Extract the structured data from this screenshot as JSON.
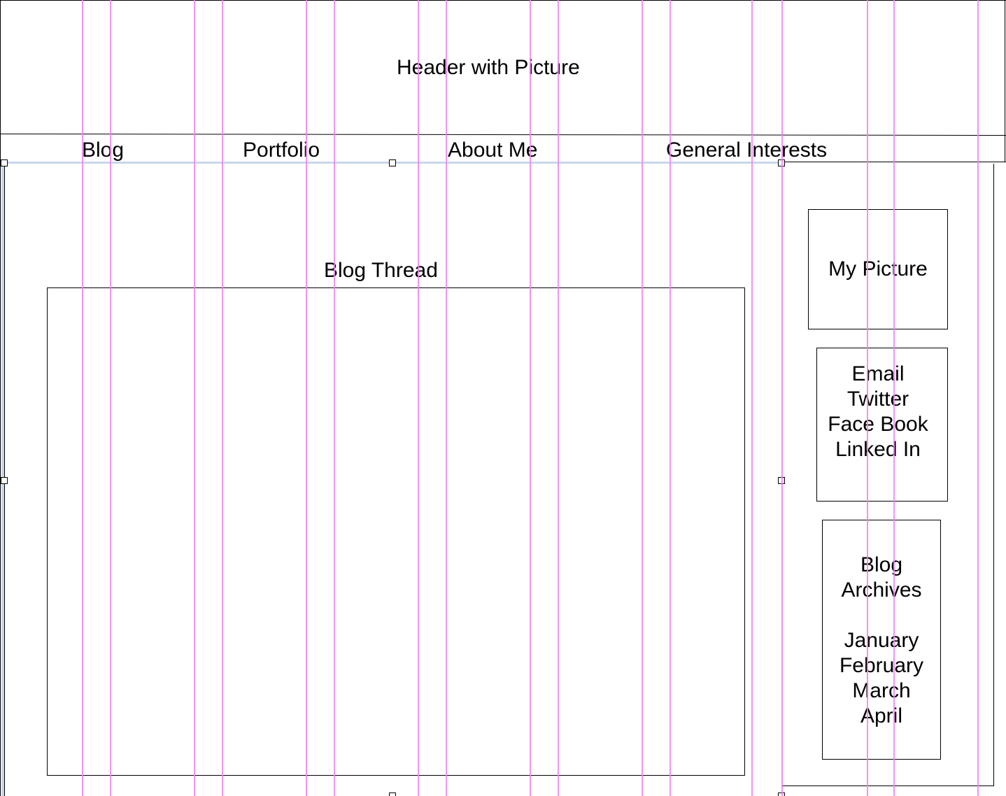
{
  "header": {
    "label": "Header with Picture"
  },
  "nav": {
    "items": [
      {
        "label": "Blog"
      },
      {
        "label": "Portfolio"
      },
      {
        "label": "About Me"
      },
      {
        "label": "General Interests"
      }
    ]
  },
  "main": {
    "blog_thread_label": "Blog Thread"
  },
  "sidebar": {
    "picture_label": "My Picture",
    "social_links": [
      "Email",
      "Twitter",
      "Face Book",
      "Linked In"
    ],
    "archives": {
      "title_lines": [
        "Blog",
        "Archives"
      ],
      "months": [
        "January",
        "February",
        "March",
        "April"
      ]
    }
  },
  "colors": {
    "guide": "#ee82ee",
    "border": "#000000",
    "selection": "#c9d6ea"
  }
}
